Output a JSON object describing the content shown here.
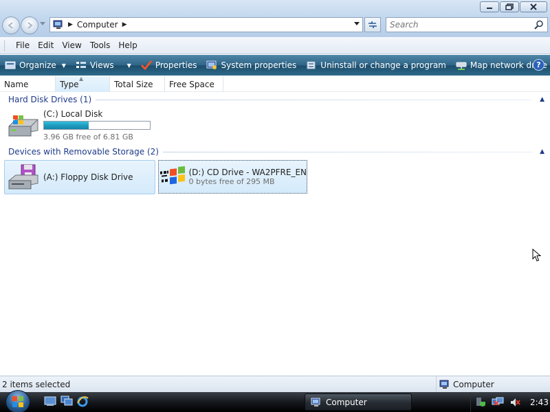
{
  "window": {
    "icons": [
      "minimize-icon",
      "maximize-icon",
      "close-icon"
    ]
  },
  "address": {
    "crumb": "Computer",
    "search_placeholder": "Search"
  },
  "menu": [
    "File",
    "Edit",
    "View",
    "Tools",
    "Help"
  ],
  "commands": {
    "organize": "Organize",
    "views": "Views",
    "properties": "Properties",
    "system_properties": "System properties",
    "uninstall": "Uninstall or change a program",
    "map_drive": "Map network drive",
    "more": "»",
    "help": "?"
  },
  "columns": [
    "Name",
    "Type",
    "Total Size",
    "Free Space"
  ],
  "groups": [
    {
      "title": "Hard Disk Drives (1)",
      "items": [
        {
          "name": "(C:) Local Disk",
          "free_text": "3.96 GB free of 6.81 GB",
          "used_fraction": 0.42
        }
      ]
    },
    {
      "title": "Devices with Removable Storage (2)",
      "items": [
        {
          "name": "(A:) Floppy Disk Drive",
          "selected": true
        },
        {
          "name": "(D:) CD Drive - WA2PFRE_EN",
          "free_text": "0 bytes free of 295 MB",
          "selected": true,
          "focused": true
        }
      ]
    }
  ],
  "status": {
    "selection": "2 items selected",
    "location": "Computer"
  },
  "taskbar": {
    "active_window": "Computer",
    "clock": "2:43"
  },
  "colors": {
    "command_bar": "#2f6587",
    "selection": "#d4eafb",
    "group_header": "#1e3a8a",
    "capacity_fill": "#1f9cc0"
  }
}
